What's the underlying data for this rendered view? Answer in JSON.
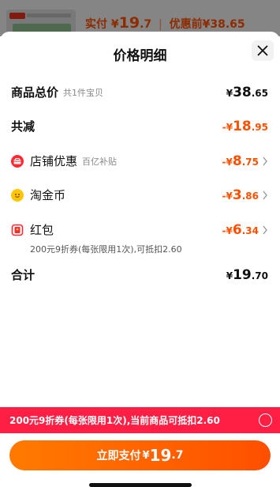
{
  "background": {
    "pay_label": "实付",
    "pay_currency": "¥",
    "pay_int": "19",
    "pay_dec": ".7",
    "separator": "|",
    "before_label": "优惠前",
    "before_price": "¥38.65"
  },
  "sheet": {
    "title": "价格明细",
    "close_icon": "close-icon"
  },
  "rows": {
    "total": {
      "label": "商品总价",
      "sub": "共1件宝贝",
      "currency": "¥",
      "int": "38",
      "dec": ".65"
    },
    "reduce": {
      "label": "共减",
      "currency": "-¥",
      "int": "18",
      "dec": ".95"
    },
    "shop": {
      "label": "店铺优惠",
      "sub": "百亿补贴",
      "currency": "-¥",
      "int": "8",
      "dec": ".75"
    },
    "coin": {
      "label": "淘金币",
      "currency": "-¥",
      "int": "3",
      "dec": ".86"
    },
    "redpack": {
      "label": "红包",
      "currency": "-¥",
      "int": "6",
      "dec": ".34",
      "note": "200元9折券(每张限用1次),可抵扣2.60"
    },
    "sum": {
      "label": "合计",
      "currency": "¥",
      "int": "19",
      "dec": ".70"
    }
  },
  "coupon_bar": {
    "text": "200元9折券(每张限用1次),当前商品可抵扣2.60"
  },
  "pay_button": {
    "label": "立即支付",
    "currency": "¥",
    "int": "19",
    "dec": ".7"
  },
  "colors": {
    "accent": "#ff5000",
    "coupon": "#ff1f44",
    "red_icon": "#ff2a32",
    "coin_icon": "#ffc500"
  }
}
